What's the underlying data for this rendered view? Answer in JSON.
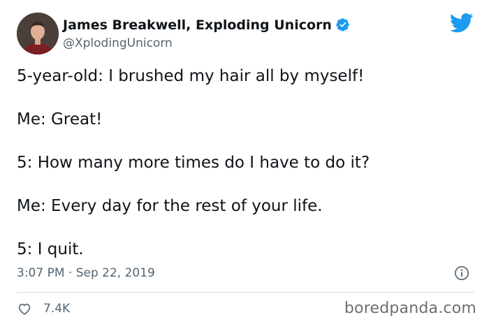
{
  "author": {
    "display_name": "James Breakwell, Exploding Unicorn",
    "handle": "@XplodingUnicorn",
    "avatar_icon": "profile-photo",
    "verified_icon": "verified-badge-icon"
  },
  "tweet": {
    "lines": [
      "5-year-old: I brushed my hair all by myself!",
      "Me: Great!",
      "5: How many more times do I have to do it?",
      "Me: Every day for the rest of your life.",
      "5: I quit."
    ],
    "timestamp": "3:07 PM · Sep 22, 2019"
  },
  "engagement": {
    "likes": "7.4K"
  },
  "watermark": "boredpanda.com",
  "colors": {
    "twitter_blue": "#1d9bf0",
    "secondary_text": "#536471",
    "divider": "#cfd9de"
  }
}
